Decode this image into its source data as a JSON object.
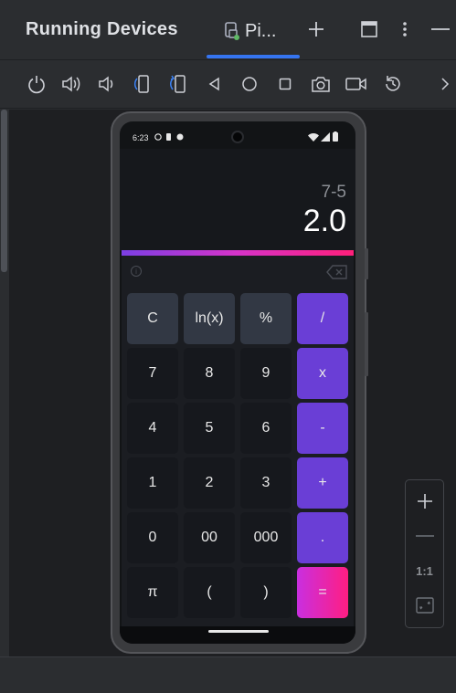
{
  "panel": {
    "title": "Running Devices",
    "tab_label": "Pi...",
    "add_tab_label": "+",
    "more_label": "⋮",
    "minimize_label": "—"
  },
  "toolbar": {
    "icons": [
      "power-icon",
      "volume-up-icon",
      "volume-down-icon",
      "rotate-left-icon",
      "rotate-right-icon",
      "back-icon",
      "home-icon",
      "overview-icon",
      "screenshot-icon",
      "screen-record-icon",
      "reset-icon",
      "chevron-right-icon"
    ]
  },
  "phone": {
    "status": {
      "time": "6:23"
    },
    "calculator": {
      "expression": "7-5",
      "result": "2.0",
      "keys": [
        {
          "label": "C",
          "kind": "fn"
        },
        {
          "label": "ln(x)",
          "kind": "fn"
        },
        {
          "label": "%",
          "kind": "fn"
        },
        {
          "label": "/",
          "kind": "op"
        },
        {
          "label": "7",
          "kind": "num"
        },
        {
          "label": "8",
          "kind": "num"
        },
        {
          "label": "9",
          "kind": "num"
        },
        {
          "label": "x",
          "kind": "op"
        },
        {
          "label": "4",
          "kind": "num"
        },
        {
          "label": "5",
          "kind": "num"
        },
        {
          "label": "6",
          "kind": "num"
        },
        {
          "label": "-",
          "kind": "op"
        },
        {
          "label": "1",
          "kind": "num"
        },
        {
          "label": "2",
          "kind": "num"
        },
        {
          "label": "3",
          "kind": "num"
        },
        {
          "label": "+",
          "kind": "op"
        },
        {
          "label": "0",
          "kind": "num"
        },
        {
          "label": "00",
          "kind": "num"
        },
        {
          "label": "000",
          "kind": "num"
        },
        {
          "label": ".",
          "kind": "op"
        },
        {
          "label": "π",
          "kind": "num"
        },
        {
          "label": "(",
          "kind": "num"
        },
        {
          "label": ")",
          "kind": "num"
        },
        {
          "label": "=",
          "kind": "eq"
        }
      ]
    }
  },
  "zoom": {
    "zoom_in_label": "+",
    "zoom_out_label": "—",
    "actual_size_label": "1:1"
  }
}
